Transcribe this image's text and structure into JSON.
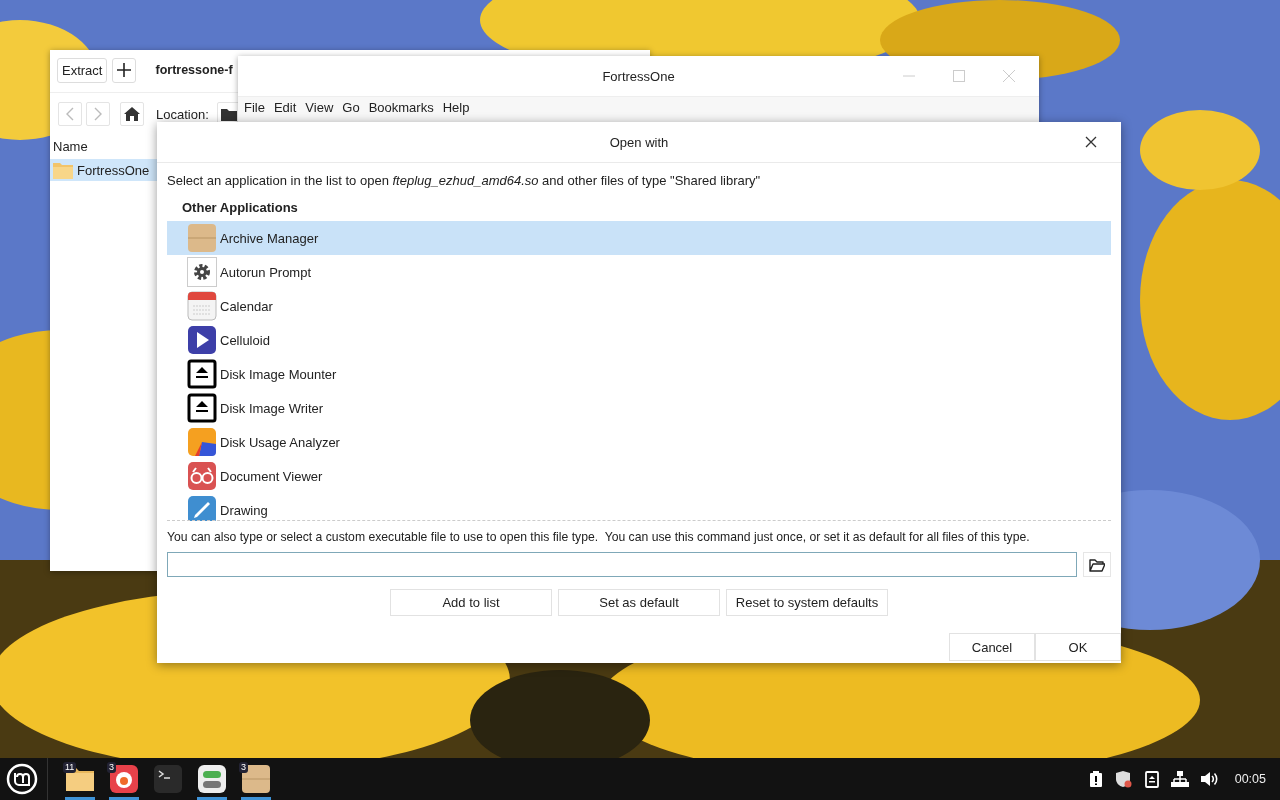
{
  "archive_window": {
    "extract_button": "Extract",
    "title": "fortressone-f",
    "location_label": "Location:",
    "column": "Name",
    "rows": [
      {
        "name": "FortressOne",
        "selected": true
      }
    ]
  },
  "file_window": {
    "title": "FortressOne",
    "menu": [
      "File",
      "Edit",
      "View",
      "Go",
      "Bookmarks",
      "Help"
    ]
  },
  "dialog": {
    "title": "Open with",
    "prompt": "Select an application in the list to open *fteplug_ezhud_amd64.so* and other files of type \"Shared library\"",
    "section": "Other Applications",
    "apps": [
      {
        "name": "Archive Manager",
        "kind": "archive",
        "selected": true
      },
      {
        "name": "Autorun Prompt",
        "kind": "gear",
        "selected": false
      },
      {
        "name": "Calendar",
        "kind": "calendar",
        "selected": false
      },
      {
        "name": "Celluloid",
        "kind": "play",
        "selected": false
      },
      {
        "name": "Disk Image Mounter",
        "kind": "eject",
        "selected": false
      },
      {
        "name": "Disk Image Writer",
        "kind": "eject",
        "selected": false
      },
      {
        "name": "Disk Usage Analyzer",
        "kind": "pie",
        "selected": false
      },
      {
        "name": "Document Viewer",
        "kind": "glasses",
        "selected": false
      },
      {
        "name": "Drawing",
        "kind": "pencil",
        "selected": false
      }
    ],
    "custom_hint": "You can also type or select a custom executable file to use to open this file type.  You can use this command just once, or set it as default for all files of this type.",
    "buttons": [
      "Add to list",
      "Set as default",
      "Reset to system defaults"
    ],
    "footer_buttons": [
      "Cancel",
      "OK"
    ]
  },
  "taskbar": {
    "apps": [
      {
        "kind": "folder",
        "badge": "11",
        "running": true
      },
      {
        "kind": "browser",
        "badge": "3",
        "running": true
      },
      {
        "kind": "terminal",
        "running": false
      },
      {
        "kind": "toggles",
        "running": true
      },
      {
        "kind": "archive",
        "badge": "3",
        "running": true
      }
    ],
    "clock": "00:05"
  }
}
